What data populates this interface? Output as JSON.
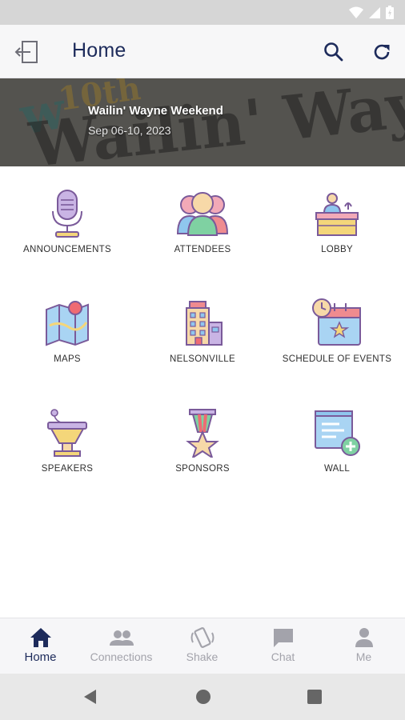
{
  "app_bar": {
    "title": "Home"
  },
  "banner": {
    "event_title": "Wailin' Wayne Weekend",
    "event_dates": "Sep 06-10, 2023",
    "art_text_top": "10th",
    "art_text_main": "Wailin' Wayne"
  },
  "grid": {
    "items": [
      {
        "label": "ANNOUNCEMENTS",
        "icon": "microphone-icon"
      },
      {
        "label": "ATTENDEES",
        "icon": "people-icon"
      },
      {
        "label": "LOBBY",
        "icon": "reception-desk-icon"
      },
      {
        "label": "MAPS",
        "icon": "map-icon"
      },
      {
        "label": "NELSONVILLE",
        "icon": "buildings-icon"
      },
      {
        "label": "SCHEDULE OF EVENTS",
        "icon": "calendar-clock-icon"
      },
      {
        "label": "SPEAKERS",
        "icon": "podium-icon"
      },
      {
        "label": "SPONSORS",
        "icon": "medal-icon"
      },
      {
        "label": "WALL",
        "icon": "note-add-icon"
      }
    ]
  },
  "bottom_nav": {
    "items": [
      {
        "label": "Home",
        "icon": "home-icon",
        "active": true
      },
      {
        "label": "Connections",
        "icon": "group-icon",
        "active": false
      },
      {
        "label": "Shake",
        "icon": "shake-phone-icon",
        "active": false
      },
      {
        "label": "Chat",
        "icon": "chat-icon",
        "active": false
      },
      {
        "label": "Me",
        "icon": "person-icon",
        "active": false
      }
    ]
  },
  "colors": {
    "title_navy": "#1d2b5b",
    "nav_inactive": "#a3a3ab",
    "status_bar": "#d6d6d6",
    "icon_purple": "#b79ad0",
    "icon_yellow": "#f4d67a",
    "icon_blue": "#8fc6ee",
    "icon_green": "#7fd1a2",
    "icon_pink": "#f2a9b7",
    "icon_red": "#ef6b73"
  }
}
